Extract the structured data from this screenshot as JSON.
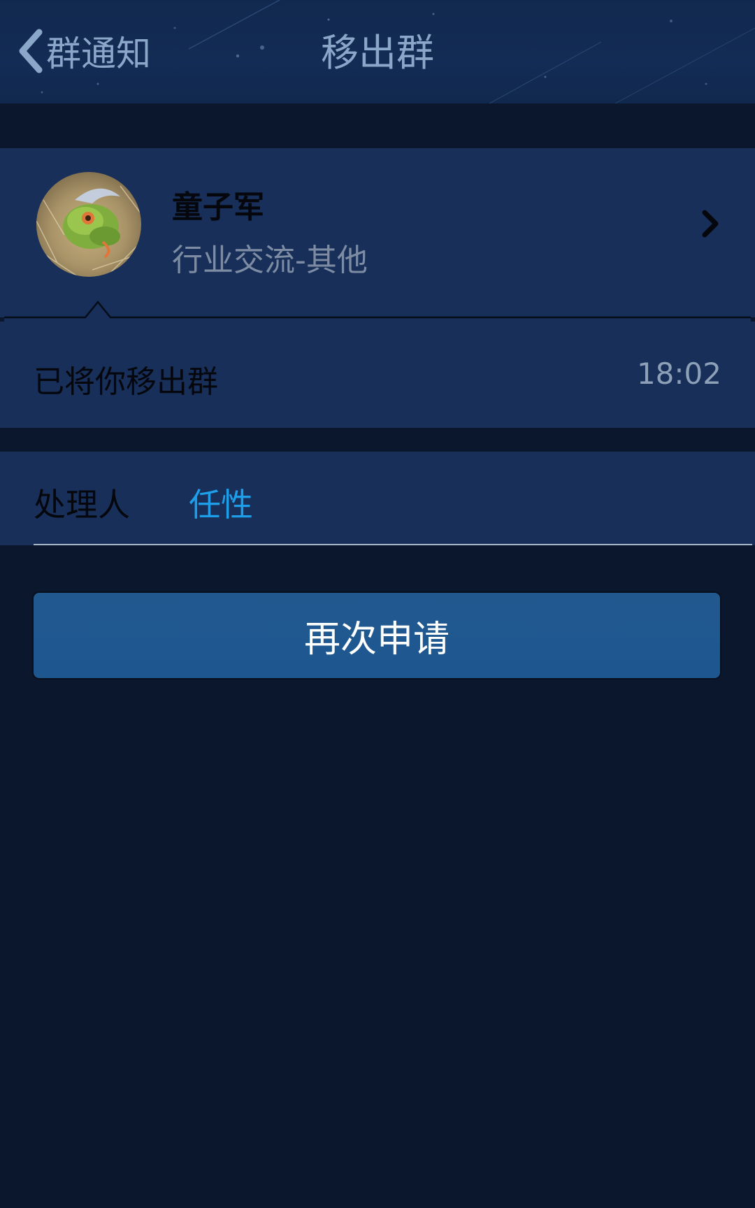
{
  "header": {
    "back_label": "群通知",
    "title": "移出群"
  },
  "group": {
    "name": "童子军",
    "category": "行业交流-其他"
  },
  "notice": {
    "text": "已将你移出群",
    "time": "18:02"
  },
  "handler": {
    "label": "处理人",
    "name": "任性"
  },
  "actions": {
    "reapply_label": "再次申请"
  },
  "colors": {
    "background": "#0a172d",
    "panel": "#172f59",
    "header": "#132c55",
    "accent_link": "#1e9ee8",
    "button": "#1f5890"
  }
}
